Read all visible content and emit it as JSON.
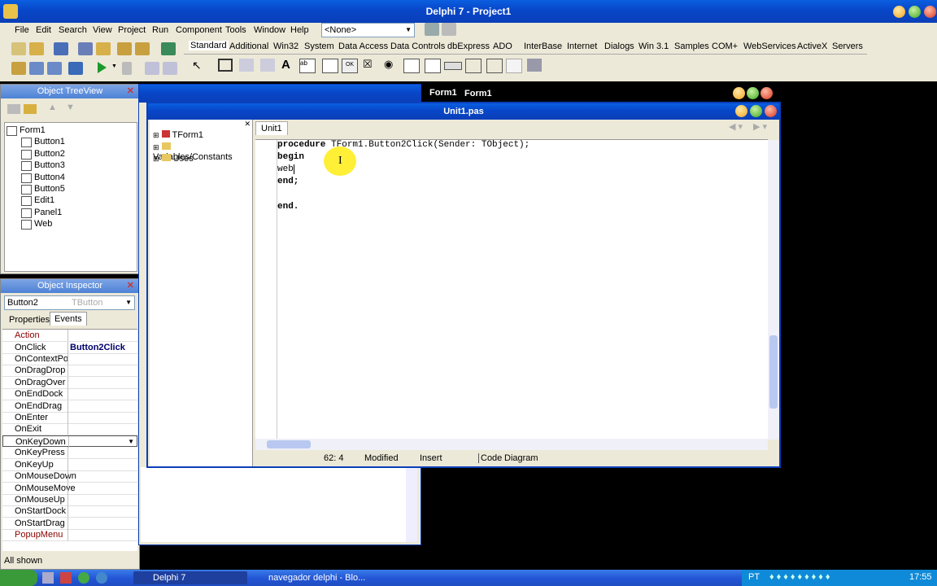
{
  "ide": {
    "title": "Delphi 7 - Project1",
    "menu": [
      "File",
      "Edit",
      "Search",
      "View",
      "Project",
      "Run",
      "Component",
      "Tools",
      "Window",
      "Help"
    ],
    "combo_value": "<None>",
    "palette_tabs": [
      "Standard",
      "Additional",
      "Win32",
      "System",
      "Data Access",
      "Data Controls",
      "dbExpress",
      "ADO",
      "InterBase",
      "Internet",
      "Dialogs",
      "Win 3.1",
      "Samples",
      "COM+",
      "WebServices",
      "ActiveX",
      "Servers"
    ]
  },
  "treeview": {
    "title": "Object TreeView",
    "items": [
      "Form1",
      "Button1",
      "Button2",
      "Button3",
      "Button4",
      "Button5",
      "Edit1",
      "Panel1",
      "Web"
    ]
  },
  "inspector": {
    "title": "Object Inspector",
    "object_name": "Button2",
    "object_type": "TButton",
    "tabs": [
      "Properties",
      "Events"
    ],
    "rows": [
      {
        "name": "Action",
        "value": ""
      },
      {
        "name": "OnClick",
        "value": "Button2Click"
      },
      {
        "name": "OnContextPopup",
        "value": ""
      },
      {
        "name": "OnDragDrop",
        "value": ""
      },
      {
        "name": "OnDragOver",
        "value": ""
      },
      {
        "name": "OnEndDock",
        "value": ""
      },
      {
        "name": "OnEndDrag",
        "value": ""
      },
      {
        "name": "OnEnter",
        "value": ""
      },
      {
        "name": "OnExit",
        "value": ""
      },
      {
        "name": "OnKeyDown",
        "value": ""
      },
      {
        "name": "OnKeyPress",
        "value": ""
      },
      {
        "name": "OnKeyUp",
        "value": ""
      },
      {
        "name": "OnMouseDown",
        "value": ""
      },
      {
        "name": "OnMouseMove",
        "value": ""
      },
      {
        "name": "OnMouseUp",
        "value": ""
      },
      {
        "name": "OnStartDock",
        "value": ""
      },
      {
        "name": "OnStartDrag",
        "value": ""
      },
      {
        "name": "PopupMenu",
        "value": ""
      }
    ],
    "status": "All shown"
  },
  "form1": {
    "title": "Form1"
  },
  "editor": {
    "title": "Unit1.pas",
    "tab": "Unit1",
    "explorer": [
      "TForm1",
      "Variables/Constants",
      "Uses"
    ],
    "code": {
      "line1_kw": "procedure",
      "line1_rest": " TForm1.Button2Click(Sender: TObject);",
      "line2": "begin",
      "line3": "web",
      "line4": "end;",
      "line5": "end."
    },
    "status": {
      "pos": "62:  4",
      "modified": "Modified",
      "mode": "Insert",
      "tab_code": "Code",
      "tab_diagram": "Diagram"
    }
  },
  "taskbar": {
    "items": [
      "Delphi 7",
      "navegador delphi - Blo..."
    ],
    "lang": "PT",
    "clock": "17:55"
  }
}
